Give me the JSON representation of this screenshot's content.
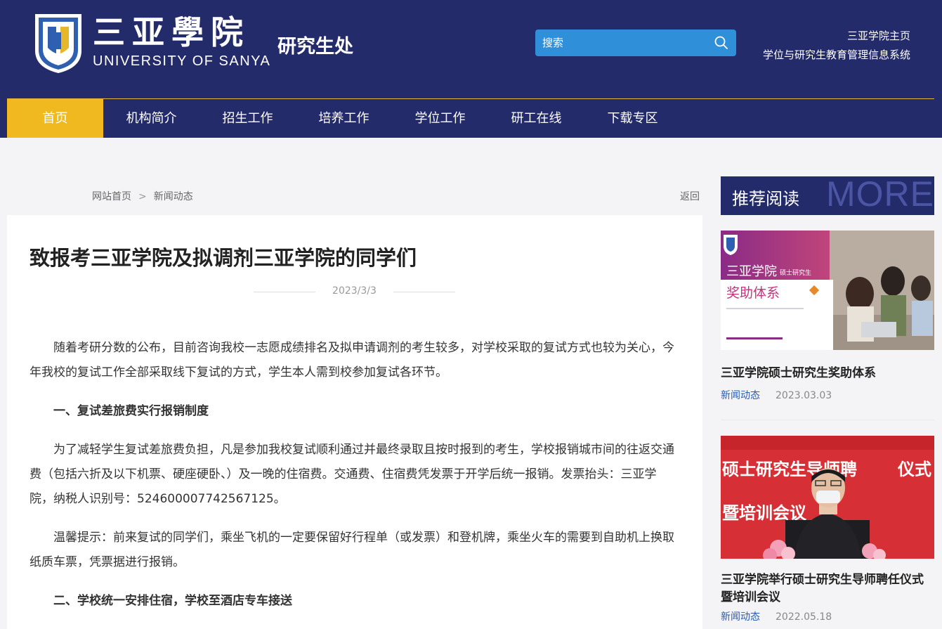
{
  "header": {
    "logo_cn": "三亚學院",
    "logo_en": "UNIVERSITY OF SANYA",
    "seal_text": "UNIVERSITY OF SANYA",
    "department": "研究生处",
    "search_placeholder": "搜索",
    "top_links": [
      "三亚学院主页",
      "学位与研究生教育管理信息系统"
    ]
  },
  "nav": {
    "items": [
      "首页",
      "机构简介",
      "招生工作",
      "培养工作",
      "学位工作",
      "研工在线",
      "下载专区"
    ],
    "active_index": 0
  },
  "breadcrumb": {
    "home": "网站首页",
    "separator": ">",
    "current": "新闻动态",
    "back": "返回"
  },
  "article": {
    "title": "致报考三亚学院及拟调剂三亚学院的同学们",
    "date": "2023/3/3",
    "paragraphs": [
      "随着考研分数的公布，目前咨询我校一志愿成绩排名及拟申请调剂的考生较多，对学校采取的复试方式也较为关心，今年我校的复试工作全部采取线下复试的方式，学生本人需到校参加复试各环节。",
      "一、复试差旅费实行报销制度",
      "为了减轻学生复试差旅费负担，凡是参加我校复试顺利通过并最终录取且按时报到的考生，学校报销城市间的往返交通费（包括六折及以下机票、硬座硬卧、）及一晚的住宿费。交通费、住宿费凭发票于开学后统一报销。发票抬头：三亚学院，纳税人识别号：524600007742567125。",
      "温馨提示：前来复试的同学们，乘坐飞机的一定要保留好行程单（或发票）和登机牌，乘坐火车的需要到自助机上换取纸质车票，凭票据进行报销。",
      "二、学校统一安排住宿，学校至酒店专车接送"
    ]
  },
  "sidebar": {
    "title": "推荐阅读",
    "more": "MORE",
    "cards": [
      {
        "image_lines": [
          "三亚学院",
          "硕士研究生",
          "奖助体系"
        ],
        "title": "三亚学院硕士研究生奖助体系",
        "category": "新闻动态",
        "date": "2023.03.03"
      },
      {
        "image_lines": [
          "硕士研究生导师聘",
          "仪式",
          "暨培训会议"
        ],
        "title": "三亚学院举行硕士研究生导师聘任仪式暨培训会议",
        "category": "新闻动态",
        "date": "2022.05.18"
      }
    ]
  },
  "colors": {
    "header_bg": "#242b6b",
    "nav_active": "#f0b920",
    "search_bg": "#2f8fd8",
    "link_blue": "#2a5cae"
  }
}
